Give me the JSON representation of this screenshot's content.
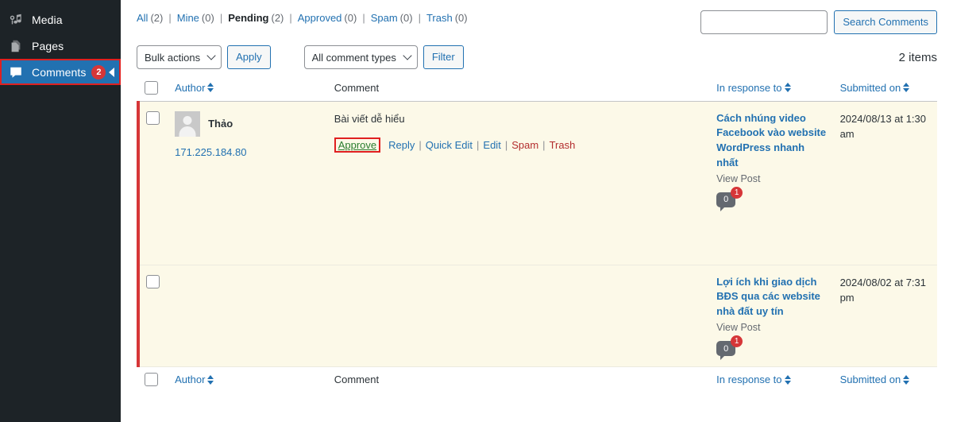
{
  "sidebar": {
    "items": [
      {
        "label": "Media",
        "icon": "media-icon",
        "badge": null,
        "active": false,
        "highlighted": false
      },
      {
        "label": "Pages",
        "icon": "pages-icon",
        "badge": null,
        "active": false,
        "highlighted": false
      },
      {
        "label": "Comments",
        "icon": "comments-icon",
        "badge": "2",
        "active": true,
        "highlighted": true
      }
    ],
    "collapse_arrow": "collapse-arrow-icon"
  },
  "filters": {
    "links": [
      {
        "label": "All",
        "count": "(2)",
        "current": false
      },
      {
        "label": "Mine",
        "count": "(0)",
        "current": false
      },
      {
        "label": "Pending",
        "count": "(2)",
        "current": true
      },
      {
        "label": "Approved",
        "count": "(0)",
        "current": false
      },
      {
        "label": "Spam",
        "count": "(0)",
        "current": false
      },
      {
        "label": "Trash",
        "count": "(0)",
        "current": false
      }
    ],
    "separator": "|"
  },
  "search": {
    "value": "",
    "placeholder": "",
    "button_label": "Search Comments"
  },
  "tablenav": {
    "bulk_actions_label": "Bulk actions",
    "apply_label": "Apply",
    "comment_types_label": "All comment types",
    "filter_label": "Filter",
    "displaying_num": "2 items"
  },
  "table": {
    "columns": {
      "author": "Author",
      "comment": "Comment",
      "response": "In response to",
      "date": "Submitted on"
    },
    "rows": [
      {
        "author_name": "Thảo",
        "author_ip": "171.225.184.80",
        "has_author": true,
        "comment_text": "Bài viết dễ hiểu",
        "has_comment": true,
        "actions": {
          "approve": "Approve",
          "reply": "Reply",
          "quick_edit": "Quick Edit",
          "edit": "Edit",
          "spam": "Spam",
          "trash": "Trash"
        },
        "post_title": "Cách nhúng video Facebook vào website WordPress nhanh nhất",
        "view_post": "View Post",
        "comment_count": "0",
        "pending_badge": "1",
        "date": "2024/08/13 at 1:30 am"
      },
      {
        "author_name": "",
        "author_ip": "",
        "has_author": false,
        "comment_text": "",
        "has_comment": false,
        "actions": null,
        "post_title": "Lợi ích khi giao dịch BĐS qua các website nhà đất uy tín",
        "view_post": "View Post",
        "comment_count": "0",
        "pending_badge": "1",
        "date": "2024/08/02 at 7:31 pm"
      }
    ]
  },
  "colors": {
    "sidebar_bg": "#1d2327",
    "active_blue": "#2271b1",
    "badge_red": "#d63638",
    "highlight_red": "#e02020",
    "pending_row_bg": "#fcf9e8",
    "approve_green": "#2a7d2e"
  }
}
